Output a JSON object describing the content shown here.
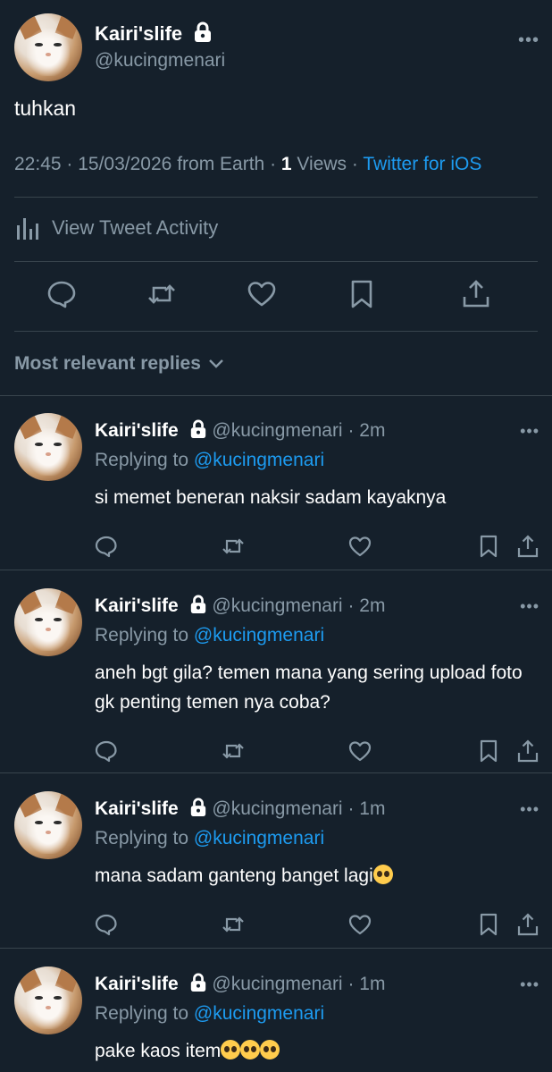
{
  "main_tweet": {
    "display_name": "Kairi'slife",
    "handle": "@kucingmenari",
    "text": "tuhkan",
    "time": "22:45",
    "date": "15/03/2026",
    "location": "from Earth",
    "views_count": "1",
    "views_label": "Views",
    "source": "Twitter for iOS",
    "activity_label": "View Tweet Activity",
    "more": "•••"
  },
  "sort_label": "Most relevant replies",
  "replies": [
    {
      "display_name": "Kairi'slife",
      "handle": "@kucingmenari",
      "time": "2m",
      "replying_prefix": "Replying to",
      "replying_handle": "@kucingmenari",
      "text": "si memet beneran naksir sadam kayaknya",
      "more": "•••"
    },
    {
      "display_name": "Kairi'slife",
      "handle": "@kucingmenari",
      "time": "2m",
      "replying_prefix": "Replying to",
      "replying_handle": "@kucingmenari",
      "text": "aneh bgt gila? temen mana yang sering upload foto gk penting temen nya coba?",
      "more": "•••"
    },
    {
      "display_name": "Kairi'slife",
      "handle": "@kucingmenari",
      "time": "1m",
      "replying_prefix": "Replying to",
      "replying_handle": "@kucingmenari",
      "text": "mana sadam ganteng banget lagi",
      "more": "•••"
    },
    {
      "display_name": "Kairi'slife",
      "handle": "@kucingmenari",
      "time": "1m",
      "replying_prefix": "Replying to",
      "replying_handle": "@kucingmenari",
      "text": "pake kaos item",
      "more": "•••"
    }
  ],
  "colors": {
    "background": "#15202b",
    "divider": "#38444d",
    "muted": "#8899a6",
    "link": "#1d9bf0"
  },
  "icons": [
    "lock-icon",
    "reply-icon",
    "retweet-icon",
    "like-icon",
    "bookmark-icon",
    "share-icon",
    "analytics-icon",
    "chevron-down-icon",
    "pleading-face-emoji"
  ]
}
